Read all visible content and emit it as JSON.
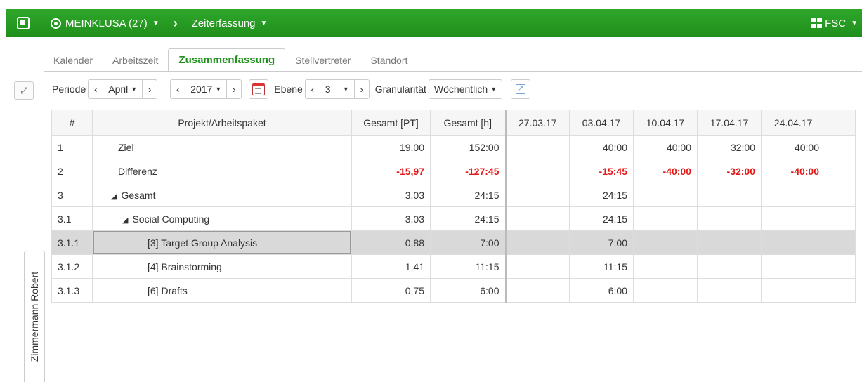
{
  "topbar": {
    "project_label": "MEINKLUSA (27)",
    "module_label": "Zeiterfassung",
    "user_label": "FSC"
  },
  "side_tab_label": "Zimmermann Robert",
  "tabs": [
    {
      "label": "Kalender",
      "active": false
    },
    {
      "label": "Arbeitszeit",
      "active": false
    },
    {
      "label": "Zusammenfassung",
      "active": true
    },
    {
      "label": "Stellvertreter",
      "active": false
    },
    {
      "label": "Standort",
      "active": false
    }
  ],
  "toolbar": {
    "periode_label": "Periode",
    "month_value": "April",
    "year_value": "2017",
    "ebene_label": "Ebene",
    "ebene_value": "3",
    "granularity_label": "Granularität",
    "granularity_value": "Wöchentlich"
  },
  "table": {
    "headers": [
      "#",
      "Projekt/Arbeitspaket",
      "Gesamt [PT]",
      "Gesamt [h]",
      "27.03.17",
      "03.04.17",
      "10.04.17",
      "17.04.17",
      "24.04.17"
    ],
    "rows": [
      {
        "num": "1",
        "name": "Ziel",
        "pt": "19,00",
        "h": "152:00",
        "w1": "",
        "w2": "40:00",
        "w3": "40:00",
        "w4": "32:00",
        "w5": "40:00"
      },
      {
        "num": "2",
        "name": "Differenz",
        "pt": "-15,97",
        "h": "-127:45",
        "w1": "",
        "w2": "-15:45",
        "w3": "-40:00",
        "w4": "-32:00",
        "w5": "-40:00"
      },
      {
        "num": "3",
        "name": "Gesamt",
        "pt": "3,03",
        "h": "24:15",
        "w1": "",
        "w2": "24:15",
        "w3": "",
        "w4": "",
        "w5": ""
      },
      {
        "num": "3.1",
        "name": "Social Computing",
        "pt": "3,03",
        "h": "24:15",
        "w1": "",
        "w2": "24:15",
        "w3": "",
        "w4": "",
        "w5": ""
      },
      {
        "num": "3.1.1",
        "name": "[3] Target Group Analysis",
        "pt": "0,88",
        "h": "7:00",
        "w1": "",
        "w2": "7:00",
        "w3": "",
        "w4": "",
        "w5": ""
      },
      {
        "num": "3.1.2",
        "name": "[4] Brainstorming",
        "pt": "1,41",
        "h": "11:15",
        "w1": "",
        "w2": "11:15",
        "w3": "",
        "w4": "",
        "w5": ""
      },
      {
        "num": "3.1.3",
        "name": "[6] Drafts",
        "pt": "0,75",
        "h": "6:00",
        "w1": "",
        "w2": "6:00",
        "w3": "",
        "w4": "",
        "w5": ""
      }
    ]
  },
  "colors": {
    "brand_green": "#1f8f1c",
    "negative_red": "#e31919",
    "selected_row": "#d9d9d9"
  }
}
